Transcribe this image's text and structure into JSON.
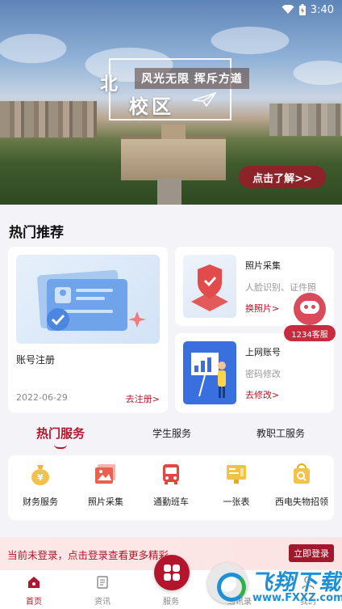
{
  "status_bar": {
    "time": "3:40",
    "wifi_icon": "wifi-icon",
    "battery_icon": "battery-icon"
  },
  "banner": {
    "calligraphy_1": "北",
    "calligraphy_2": "校区",
    "slogan": "风光无限 挥斥方遒",
    "learn_more": "点击了解>>"
  },
  "hot_section": {
    "title": "热门推荐",
    "big_card": {
      "name": "账号注册",
      "date": "2022-06-29",
      "link": "去注册>"
    },
    "small_cards": [
      {
        "name": "照片采集",
        "desc": "人脸识别、证件照",
        "link": "换照片>"
      },
      {
        "name": "上网账号",
        "desc": "密码修改",
        "link": "去修改>"
      }
    ]
  },
  "assistant": {
    "label": "1234客服"
  },
  "service_tabs": [
    {
      "label": "热门服务",
      "active": true
    },
    {
      "label": "学生服务",
      "active": false
    },
    {
      "label": "教职工服务",
      "active": false
    }
  ],
  "services": [
    {
      "label": "财务服务",
      "icon": "money-bag-icon"
    },
    {
      "label": "照片采集",
      "icon": "photo-icon"
    },
    {
      "label": "通勤班车",
      "icon": "bus-icon"
    },
    {
      "label": "一张表",
      "icon": "table-icon"
    },
    {
      "label": "西电失物招领",
      "icon": "lost-found-icon"
    }
  ],
  "login_prompt": {
    "message": "当前未登录，点击登录查看更多精彩~",
    "button": "立即登录"
  },
  "bottom_nav": [
    {
      "label": "首页",
      "icon": "home-icon",
      "active": true
    },
    {
      "label": "资讯",
      "icon": "news-icon",
      "active": false
    },
    {
      "label": "服务",
      "icon": "apps-icon",
      "active": false
    },
    {
      "label": "通讯录",
      "icon": "contacts-icon",
      "active": false
    },
    {
      "label": "我的",
      "icon": "profile-icon",
      "active": false
    }
  ],
  "watermark": {
    "title": "飞翔下载",
    "url": "www.FXXZ.com"
  },
  "colors": {
    "accent": "#b3162c",
    "background": "#f4f4f8"
  }
}
